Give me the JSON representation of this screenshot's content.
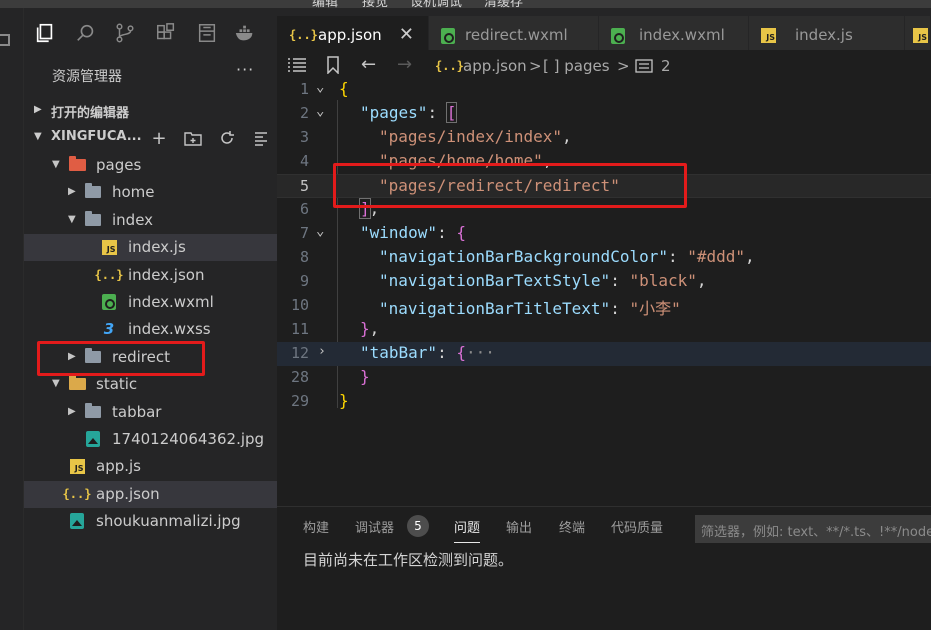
{
  "menu": [
    "编辑",
    "接觉",
    "设机调试",
    "清缓存"
  ],
  "explorer": {
    "title": "资源管理器",
    "more": "···",
    "open_editors_label": "打开的编辑器",
    "project_label": "XINGFUCA..."
  },
  "tree": [
    {
      "name": "pages",
      "type": "folder-red",
      "depth": 1,
      "open": true
    },
    {
      "name": "home",
      "type": "folder",
      "depth": 2,
      "open": false
    },
    {
      "name": "index",
      "type": "folder",
      "depth": 2,
      "open": true
    },
    {
      "name": "index.js",
      "type": "js",
      "depth": 3
    },
    {
      "name": "index.json",
      "type": "json",
      "depth": 3
    },
    {
      "name": "index.wxml",
      "type": "wxml",
      "depth": 3
    },
    {
      "name": "index.wxss",
      "type": "css",
      "depth": 3
    },
    {
      "name": "redirect",
      "type": "folder",
      "depth": 2,
      "open": false
    },
    {
      "name": "static",
      "type": "folder-open",
      "depth": 1,
      "open": true
    },
    {
      "name": "tabbar",
      "type": "folder",
      "depth": 2,
      "open": false
    },
    {
      "name": "1740124064362.jpg",
      "type": "img",
      "depth": 2
    },
    {
      "name": "app.js",
      "type": "js",
      "depth": 1
    },
    {
      "name": "app.json",
      "type": "json",
      "depth": 1
    },
    {
      "name": "shoukuanmalizi.jpg",
      "type": "img",
      "depth": 1
    }
  ],
  "tabs": [
    {
      "label": "app.json",
      "icon": "json",
      "active": true,
      "close": "✕"
    },
    {
      "label": "redirect.wxml",
      "icon": "wxml",
      "active": false
    },
    {
      "label": "index.wxml",
      "icon": "wxml",
      "active": false
    },
    {
      "label": "index.js",
      "icon": "js",
      "active": false
    }
  ],
  "breadcrumb": {
    "file": "app.json",
    "sep1": ">",
    "array": "[ ] pages",
    "sep2": ">",
    "item": "2"
  },
  "icons": {
    "json": "{..}",
    "js": "JS",
    "css": "3"
  },
  "code": [
    {
      "n": "1",
      "fold": "open"
    },
    {
      "n": "2",
      "fold": "open"
    },
    {
      "n": "3"
    },
    {
      "n": "4"
    },
    {
      "n": "5",
      "current": true
    },
    {
      "n": "6"
    },
    {
      "n": "7",
      "fold": "open"
    },
    {
      "n": "8"
    },
    {
      "n": "9"
    },
    {
      "n": "10"
    },
    {
      "n": "11"
    },
    {
      "n": "12",
      "fold": "closed",
      "folded": true
    },
    {
      "n": "28"
    },
    {
      "n": "29"
    }
  ],
  "code_text": {
    "l1_open": "{",
    "l2_key": "\"pages\"",
    "l2_colon": ": ",
    "l2_bracket": "[",
    "l3_str": "\"pages/index/index\"",
    "l3_comma": ",",
    "l4_str": "\"pages/home/home\"",
    "l4_comma": ",",
    "l5_str": "\"pages/redirect/redirect\"",
    "l6_bracket": "]",
    "l6_comma": ",",
    "l7_key": "\"window\"",
    "l7_colon": ": ",
    "l7_brace": "{",
    "l8_key": "\"navigationBarBackgroundColor\"",
    "l8_colon": ": ",
    "l8_val": "\"#ddd\"",
    "l8_comma": ",",
    "l9_key": "\"navigationBarTextStyle\"",
    "l9_colon": ": ",
    "l9_val": "\"black\"",
    "l9_comma": ",",
    "l10_key": "\"navigationBarTitleText\"",
    "l10_colon": ": ",
    "l10_val": "\"小李\"",
    "l11_close": "}",
    "l11_comma": ",",
    "l12_key": "\"tabBar\"",
    "l12_colon": ": ",
    "l12_brace": "{",
    "l12_ellipsis": "···",
    "l28_close": "}",
    "l29_close": "}"
  },
  "panel": {
    "tabs": [
      "构建",
      "调试器",
      "问题",
      "输出",
      "终端",
      "代码质量"
    ],
    "debugger_count": "5",
    "active_tab": "问题",
    "filter_placeholder": "筛选器，例如: text、**/*.ts、!**/node_modules/**",
    "message": "目前尚未在工作区检测到问题。"
  },
  "colors": {
    "highlight_box": "#e31b1b",
    "string": "#ce9178",
    "key": "#9cdcfe",
    "bracket": "#ffd700"
  }
}
